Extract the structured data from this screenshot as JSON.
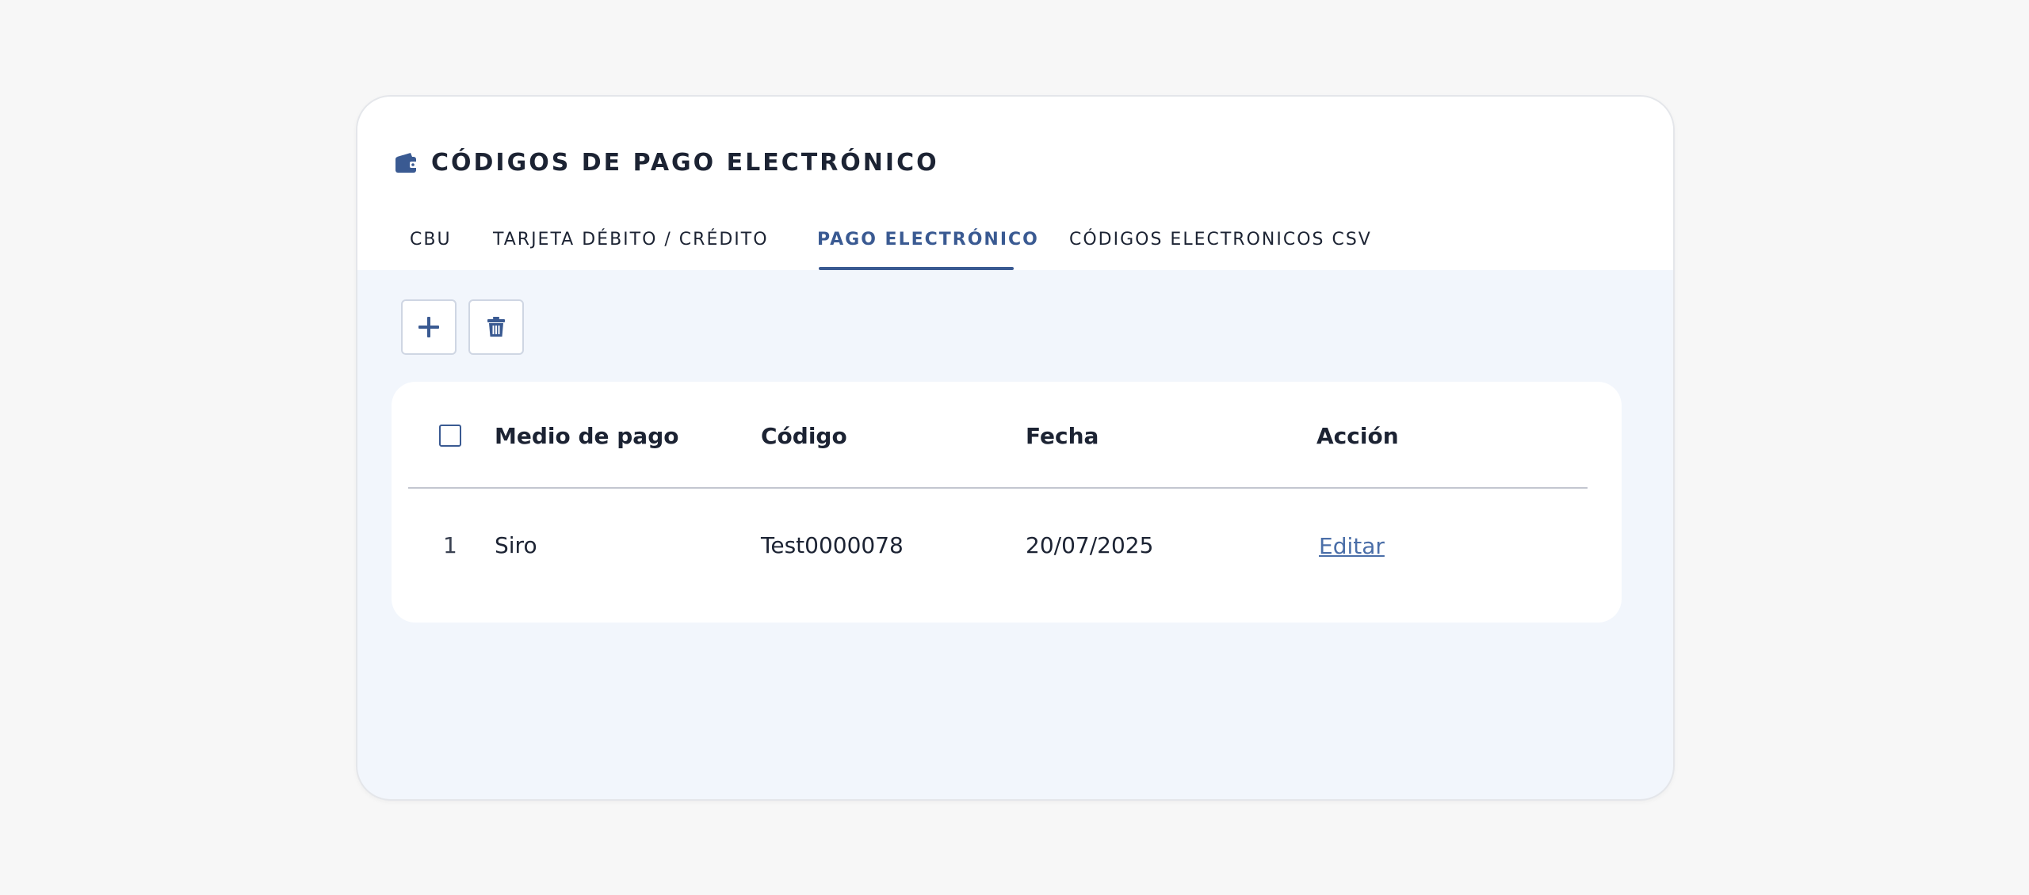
{
  "header": {
    "title": "CÓDIGOS DE PAGO ELECTRÓNICO",
    "icon": "wallet-icon"
  },
  "tabs": [
    {
      "label": "CBU",
      "active": false
    },
    {
      "label": "TARJETA DÉBITO / CRÉDITO",
      "active": false
    },
    {
      "label": "PAGO ELECTRÓNICO",
      "active": true
    },
    {
      "label": "CÓDIGOS ELECTRONICOS CSV",
      "active": false
    }
  ],
  "toolbar": {
    "add_icon": "plus-icon",
    "delete_icon": "trash-icon"
  },
  "table": {
    "columns": [
      "Medio de pago",
      "Código",
      "Fecha",
      "Acción"
    ],
    "rows": [
      {
        "index": "1",
        "medio": "Siro",
        "codigo": "Test0000078",
        "fecha": "20/07/2025",
        "accion": "Editar"
      }
    ]
  },
  "colors": {
    "accent": "#3a5a92",
    "link": "#4a6ea8",
    "panel_bg": "#f2f6fc",
    "page_bg": "#f7f7f7"
  }
}
